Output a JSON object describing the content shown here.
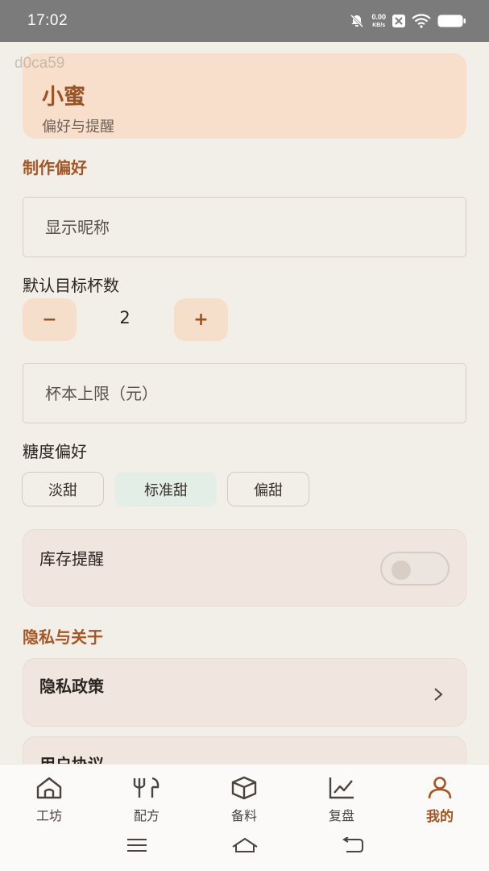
{
  "status_bar": {
    "time": "17:02",
    "net_speed_value": "0.00",
    "net_speed_unit": "KB/s",
    "icons": [
      "bell-off-icon",
      "net-speed",
      "close-box-icon",
      "wifi-icon",
      "battery-icon"
    ]
  },
  "watermark": "d0ca59",
  "header": {
    "name": "小蜜",
    "subtitle": "偏好与提醒"
  },
  "preferences": {
    "section_title": "制作偏好",
    "nickname_placeholder": "显示昵称",
    "target_cups_label": "默认目标杯数",
    "decrement_label": "−",
    "increment_label": "+",
    "target_cups_value": "2",
    "cost_limit_placeholder": "杯本上限（元）",
    "sweetness_label": "糖度偏好",
    "sweetness_options": [
      {
        "label": "淡甜",
        "selected": false
      },
      {
        "label": "标准甜",
        "selected": true
      },
      {
        "label": "偏甜",
        "selected": false
      }
    ],
    "inventory_reminder_label": "库存提醒",
    "inventory_reminder_on": false
  },
  "privacy": {
    "section_title": "隐私与关于",
    "items": [
      {
        "label": "隐私政策"
      },
      {
        "label": "用户协议"
      }
    ]
  },
  "bottom_nav": {
    "items": [
      {
        "label": "工坊",
        "icon": "home-icon",
        "active": false
      },
      {
        "label": "配方",
        "icon": "utensils-icon",
        "active": false
      },
      {
        "label": "备料",
        "icon": "box-icon",
        "active": false
      },
      {
        "label": "复盘",
        "icon": "chart-line-icon",
        "active": false
      },
      {
        "label": "我的",
        "icon": "user-icon",
        "active": true
      }
    ]
  },
  "colors": {
    "accent": "#a45625",
    "background": "#f2efe8",
    "header_card": "#f7dfcc",
    "chip_selected": "#e2eee6"
  }
}
